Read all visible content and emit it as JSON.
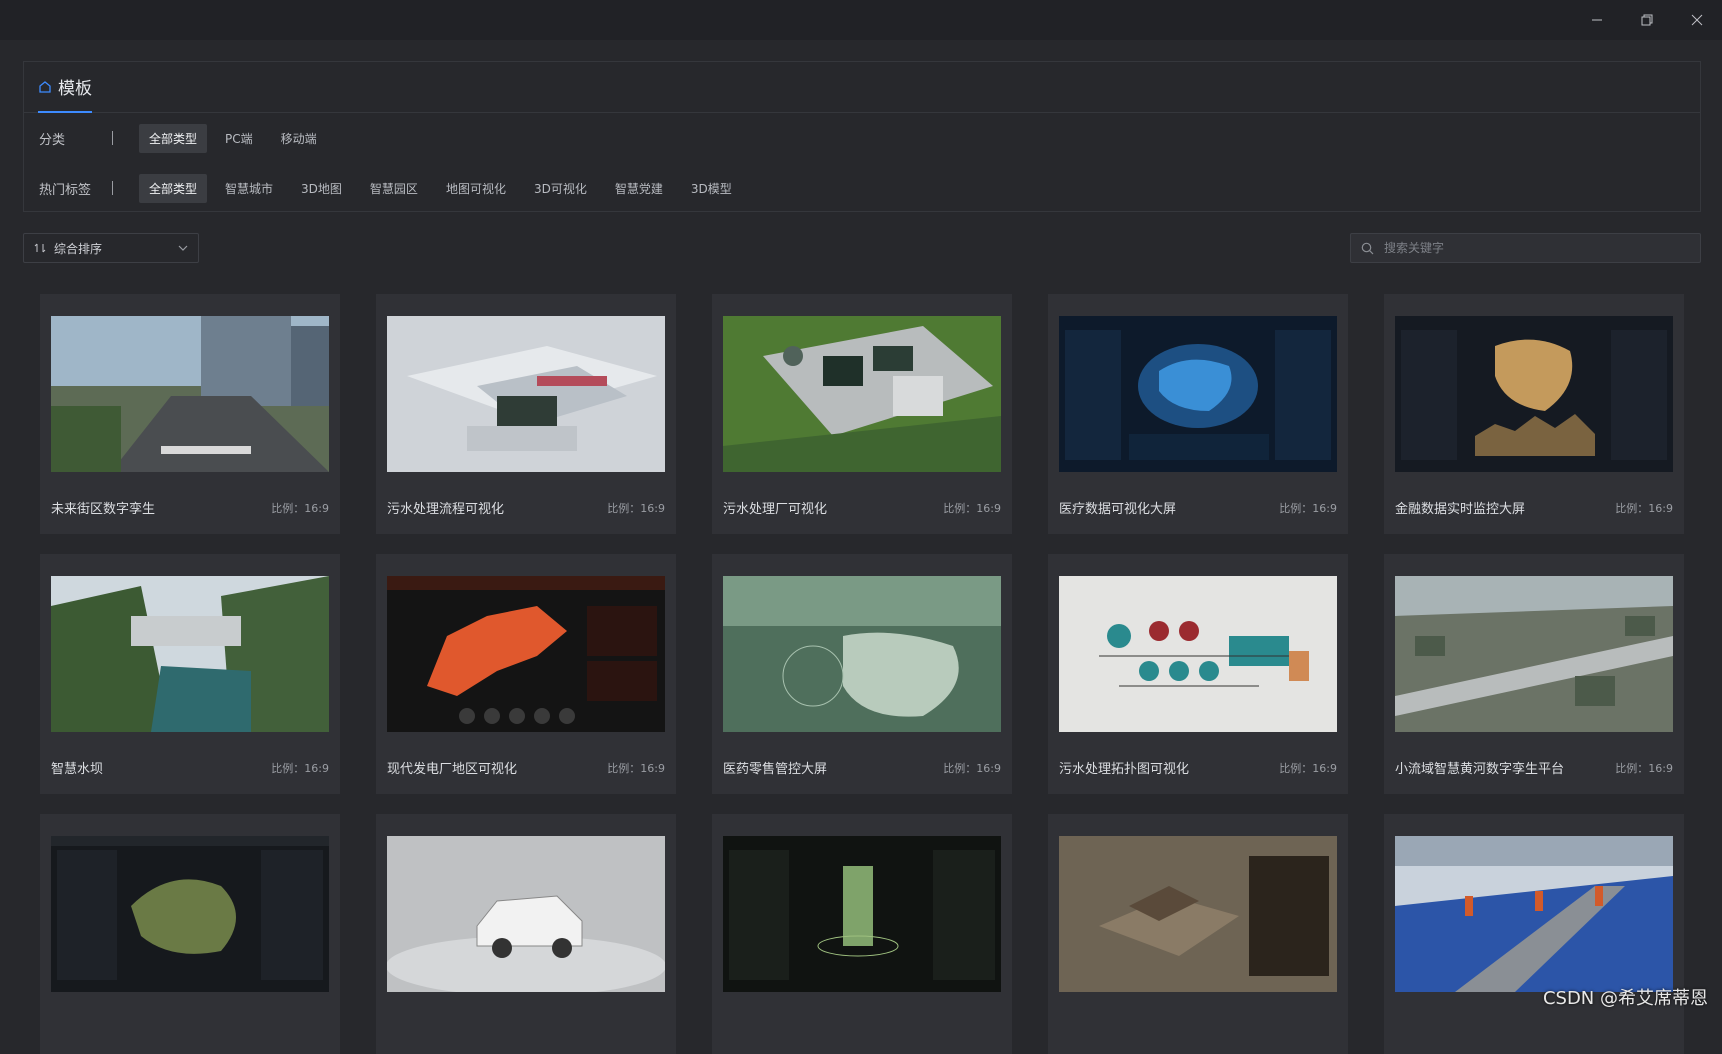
{
  "window": {
    "minimize_label": "–",
    "maximize_label": "❐",
    "close_label": "✕"
  },
  "panel": {
    "title": "模板",
    "category_label": "分类",
    "categories": [
      "全部类型",
      "PC端",
      "移动端"
    ],
    "tags_label": "热门标签",
    "tags": [
      "全部类型",
      "智慧城市",
      "3D地图",
      "智慧园区",
      "地图可视化",
      "3D可视化",
      "智慧党建",
      "3D模型"
    ]
  },
  "toolbar": {
    "sort_label": "综合排序",
    "search_placeholder": "搜索关键字"
  },
  "cards": [
    {
      "name": "未来街区数字孪生",
      "ratio": "比例：16:9"
    },
    {
      "name": "污水处理流程可视化",
      "ratio": "比例：16:9"
    },
    {
      "name": "污水处理厂可视化",
      "ratio": "比例：16:9"
    },
    {
      "name": "医疗数据可视化大屏",
      "ratio": "比例：16:9"
    },
    {
      "name": "金融数据实时监控大屏",
      "ratio": "比例：16:9"
    },
    {
      "name": "智慧水坝",
      "ratio": "比例：16:9"
    },
    {
      "name": "现代发电厂地区可视化",
      "ratio": "比例：16:9"
    },
    {
      "name": "医药零售管控大屏",
      "ratio": "比例：16:9"
    },
    {
      "name": "污水处理拓扑图可视化",
      "ratio": "比例：16:9"
    },
    {
      "name": "小流域智慧黄河数字孪生平台",
      "ratio": "比例：16:9"
    },
    {
      "name": "",
      "ratio": ""
    },
    {
      "name": "",
      "ratio": ""
    },
    {
      "name": "",
      "ratio": ""
    },
    {
      "name": "",
      "ratio": ""
    },
    {
      "name": "",
      "ratio": ""
    }
  ],
  "watermark": "CSDN @希艾席蒂恩"
}
